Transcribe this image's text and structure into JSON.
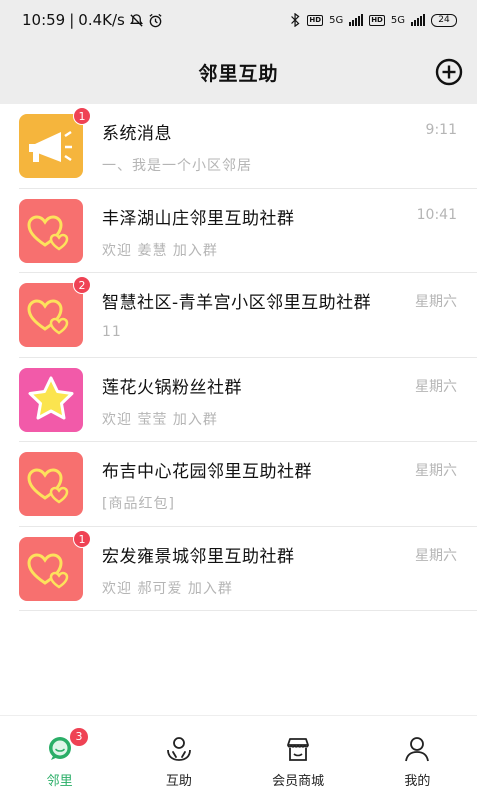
{
  "status_bar": {
    "time": "10:59",
    "speed": "0.4K/s",
    "network_1": "5G",
    "network_2": "5G",
    "battery": "24"
  },
  "header": {
    "title": "邻里互助"
  },
  "conversations": [
    {
      "name": "系统消息",
      "time": "9:11",
      "preview": "一、我是一个小区邻居",
      "badge": "1",
      "avatar": "megaphone-icon",
      "avatar_color": "#f5b53d"
    },
    {
      "name": "丰泽湖山庄邻里互助社群",
      "time": "10:41",
      "preview": "欢迎 姜慧 加入群",
      "badge": "",
      "avatar": "hearts-icon",
      "avatar_color": "#f7706f"
    },
    {
      "name": "智慧社区-青羊宫小区邻里互助社群",
      "time": "星期六",
      "preview": "11",
      "badge": "2",
      "avatar": "hearts-icon",
      "avatar_color": "#f7706f"
    },
    {
      "name": "莲花火锅粉丝社群",
      "time": "星期六",
      "preview": "欢迎 莹莹 加入群",
      "badge": "",
      "avatar": "star-icon",
      "avatar_color": "#f25aa9"
    },
    {
      "name": "布吉中心花园邻里互助社群",
      "time": "星期六",
      "preview": "[商品红包]",
      "badge": "",
      "avatar": "hearts-icon",
      "avatar_color": "#f7706f"
    },
    {
      "name": "宏发雍景城邻里互助社群",
      "time": "星期六",
      "preview": "欢迎 郝可爱 加入群",
      "badge": "1",
      "avatar": "hearts-icon",
      "avatar_color": "#f7706f"
    }
  ],
  "tabbar": {
    "tabs": [
      {
        "label": "邻里",
        "icon": "chat-icon",
        "badge": "3",
        "active": true
      },
      {
        "label": "互助",
        "icon": "helping-hands-icon",
        "badge": "",
        "active": false
      },
      {
        "label": "会员商城",
        "icon": "store-icon",
        "badge": "",
        "active": false
      },
      {
        "label": "我的",
        "icon": "person-icon",
        "badge": "",
        "active": false
      }
    ]
  },
  "colors": {
    "accent": "#2aae67",
    "badge": "#ef4254",
    "header_bg": "#ededed"
  }
}
